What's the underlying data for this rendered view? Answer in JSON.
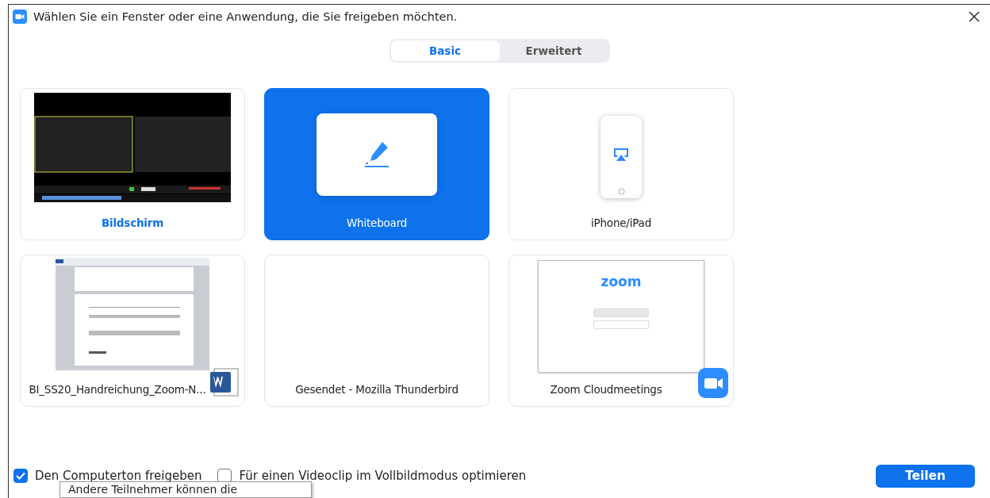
{
  "window": {
    "title": "Wählen Sie ein Fenster oder eine Anwendung, die Sie freigeben möchten."
  },
  "tabs": [
    {
      "label": "Basic",
      "selected": true
    },
    {
      "label": "Erweitert",
      "selected": false
    }
  ],
  "sources": [
    {
      "kind": "screen",
      "label": "Bildschirm",
      "selected": false,
      "label_emphasized": true
    },
    {
      "kind": "whiteboard",
      "label": "Whiteboard",
      "selected": true,
      "label_emphasized": false
    },
    {
      "kind": "device",
      "label": "iPhone/iPad",
      "selected": false,
      "label_emphasized": false
    },
    {
      "kind": "document",
      "label": "BI_SS20_Handreichung_Zoom-N...",
      "selected": false,
      "label_emphasized": false
    },
    {
      "kind": "blank",
      "label": "Gesendet - Mozilla Thunderbird",
      "selected": false,
      "label_emphasized": false
    },
    {
      "kind": "app",
      "label": "Zoom Cloudmeetings",
      "selected": false,
      "label_emphasized": false,
      "logo_text": "zoom"
    }
  ],
  "options": [
    {
      "label": "Den Computerton freigeben",
      "checked": true
    },
    {
      "label": "Für einen Videoclip im Vollbildmodus optimieren",
      "checked": false
    }
  ],
  "tooltip": {
    "text": "Andere Teilnehmer können die"
  },
  "share_button": "Teilen"
}
